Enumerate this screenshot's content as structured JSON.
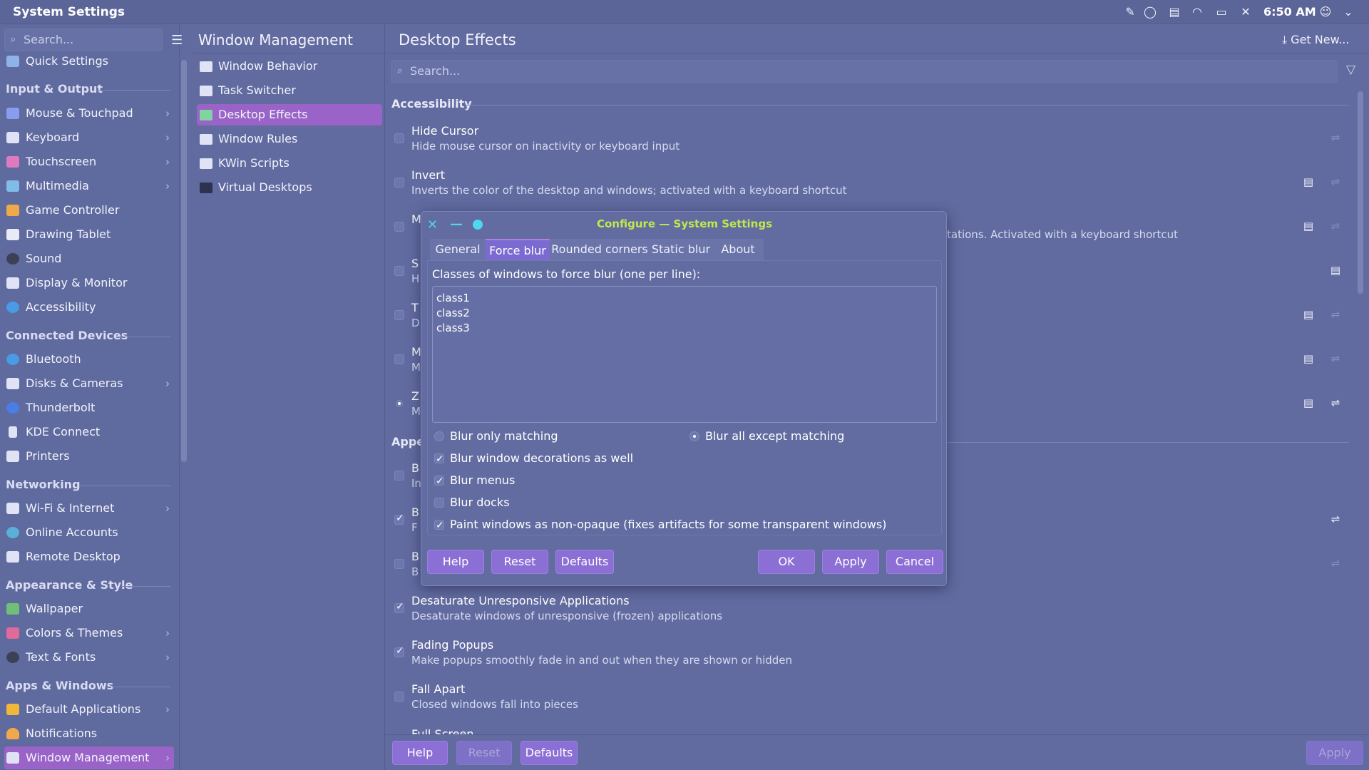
{
  "window": {
    "title": "System Settings",
    "clock": "6:50 AM"
  },
  "sidebar": {
    "search_placeholder": "Search...",
    "top_item": "Quick Settings",
    "sections": [
      {
        "header": "Input & Output",
        "items": [
          "Mouse & Touchpad",
          "Keyboard",
          "Touchscreen",
          "Multimedia",
          "Game Controller",
          "Drawing Tablet",
          "Sound",
          "Display & Monitor",
          "Accessibility"
        ]
      },
      {
        "header": "Connected Devices",
        "items": [
          "Bluetooth",
          "Disks & Cameras",
          "Thunderbolt",
          "KDE Connect",
          "Printers"
        ]
      },
      {
        "header": "Networking",
        "items": [
          "Wi-Fi & Internet",
          "Online Accounts",
          "Remote Desktop"
        ]
      },
      {
        "header": "Appearance & Style",
        "items": [
          "Wallpaper",
          "Colors & Themes",
          "Text & Fonts"
        ]
      },
      {
        "header": "Apps & Windows",
        "items": [
          "Default Applications",
          "Notifications",
          "Window Management"
        ]
      }
    ]
  },
  "subpanel": {
    "title": "Window Management",
    "items": [
      "Window Behavior",
      "Task Switcher",
      "Desktop Effects",
      "Window Rules",
      "KWin Scripts",
      "Virtual Desktops"
    ]
  },
  "main": {
    "title": "Desktop Effects",
    "get_new": "Get New...",
    "search_placeholder": "Search...",
    "group_accessibility": "Accessibility",
    "group_appearance_partial": "Appe",
    "effects": {
      "hide_cursor_title": "Hide Cursor",
      "hide_cursor_desc": "Hide mouse cursor on inactivity or keyboard input",
      "invert_title": "Invert",
      "invert_desc": "Inverts the color of the desktop and windows; activated with a keyboard shortcut",
      "magnifier_partial_title": "M",
      "magnifier_partial_desc": "tations. Activated with a keyboard shortcut",
      "row4_partial_title": "S",
      "row4_partial_desc": "H",
      "row5_partial_title": "T",
      "row5_partial_desc": "D",
      "row6_partial_title": "M",
      "row6_partial_desc": "M",
      "row7_partial_title": "Z",
      "row7_partial_desc": "M",
      "app1_partial_title": "B",
      "app1_partial_desc": "In",
      "app2_partial_title": "B",
      "app2_partial_desc": "F",
      "app3_partial_title": "B",
      "app3_partial_desc": "B",
      "desaturate_title": "Desaturate Unresponsive Applications",
      "desaturate_desc": "Desaturate windows of unresponsive (frozen) applications",
      "fading_title": "Fading Popups",
      "fading_desc": "Make popups smoothly fade in and out when they are shown or hidden",
      "fall_apart_title": "Fall Apart",
      "fall_apart_desc": "Closed windows fall into pieces",
      "full_screen_partial": "Full Screen"
    },
    "footer": {
      "help": "Help",
      "reset": "Reset",
      "defaults": "Defaults",
      "apply": "Apply"
    }
  },
  "dialog": {
    "title": "Configure — System Settings",
    "tabs": [
      "General",
      "Force blur",
      "Rounded corners",
      "Static blur",
      "About"
    ],
    "textarea_label": "Classes of windows to force blur (one per line):",
    "textarea_value": "class1\nclass2\nclass3",
    "radio_only_matching": "Blur only matching",
    "radio_all_except": "Blur all except matching",
    "opt_decorations": "Blur window decorations as well",
    "opt_menus": "Blur menus",
    "opt_docks": "Blur docks",
    "opt_paint": "Paint windows as non-opaque (fixes artifacts for some transparent windows)",
    "buttons": {
      "help": "Help",
      "reset": "Reset",
      "defaults": "Defaults",
      "ok": "OK",
      "apply": "Apply",
      "cancel": "Cancel"
    }
  },
  "colors": {
    "accent": "#9a63c8",
    "button": "#8c6fd5",
    "dialog_title": "#c3e64d",
    "close_button": "#4fd6f0"
  }
}
